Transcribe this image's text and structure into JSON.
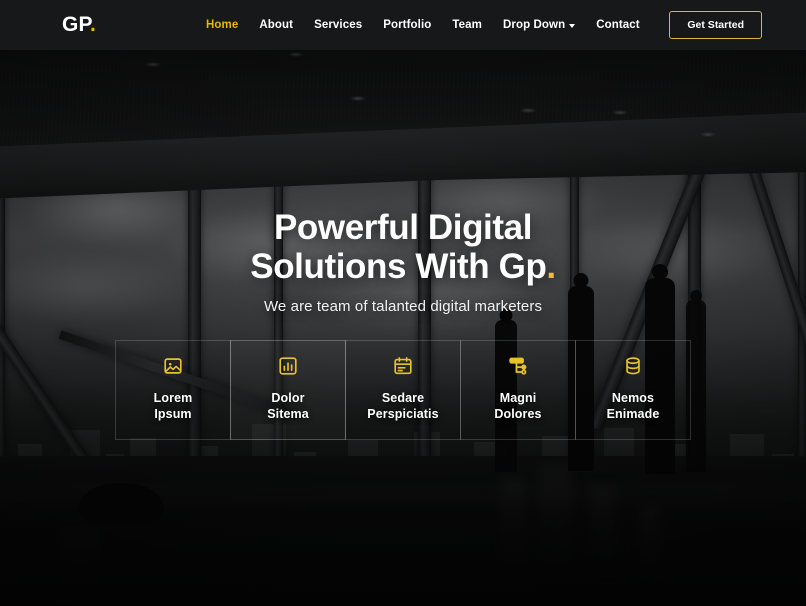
{
  "header": {
    "logo_text": "GP",
    "logo_dot": ".",
    "nav": [
      {
        "label": "Home",
        "active": true
      },
      {
        "label": "About",
        "active": false
      },
      {
        "label": "Services",
        "active": false
      },
      {
        "label": "Portfolio",
        "active": false
      },
      {
        "label": "Team",
        "active": false
      },
      {
        "label": "Drop Down",
        "active": false,
        "dropdown": true
      },
      {
        "label": "Contact",
        "active": false
      }
    ],
    "cta_label": "Get Started"
  },
  "hero": {
    "title_line1": "Powerful Digital",
    "title_line2": "Solutions With Gp",
    "title_dot": ".",
    "subtitle": "We are team of talanted digital marketers"
  },
  "features": [
    {
      "icon": "image-icon",
      "title_line1": "Lorem",
      "title_line2": "Ipsum",
      "highlight": false
    },
    {
      "icon": "chart-bar-icon",
      "title_line1": "Dolor",
      "title_line2": "Sitema",
      "highlight": true
    },
    {
      "icon": "calendar-icon",
      "title_line1": "Sedare",
      "title_line2": "Perspiciatis",
      "highlight": false
    },
    {
      "icon": "layout-icon",
      "title_line1": "Magni",
      "title_line2": "Dolores",
      "highlight": false
    },
    {
      "icon": "database-icon",
      "title_line1": "Nemos",
      "title_line2": "Enimade",
      "highlight": false
    }
  ],
  "colors": {
    "accent_gold": "#e6b800",
    "header_bg": "#17181a",
    "text_white": "#ffffff",
    "cta_border": "#e0b52a"
  }
}
